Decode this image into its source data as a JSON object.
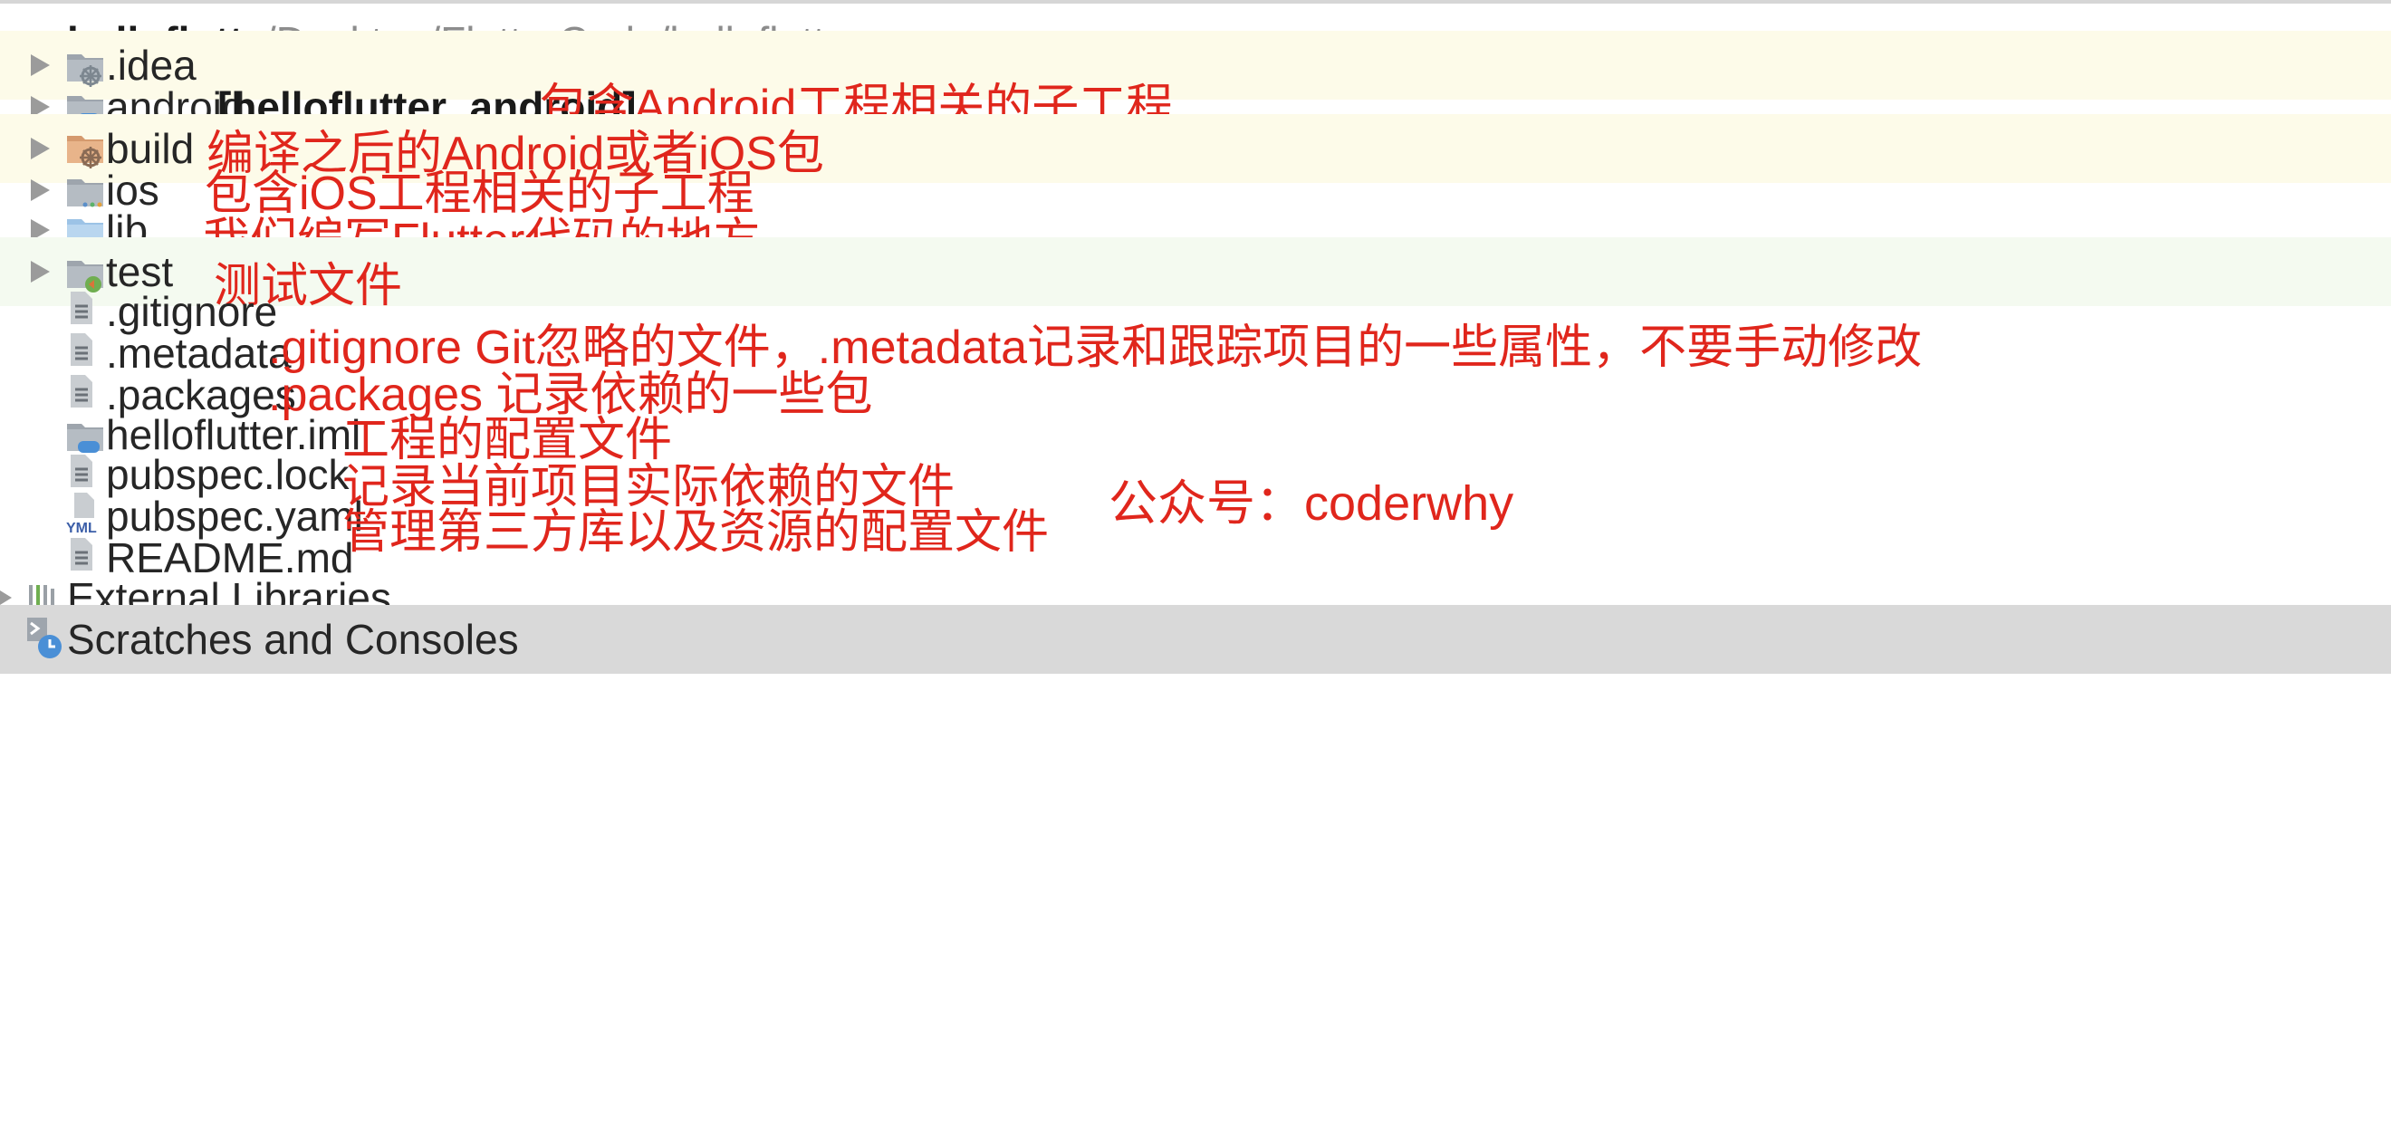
{
  "project": {
    "name": "helloflutter",
    "path": "~/Desktop/FlutterCode/helloflutter"
  },
  "tree": [
    {
      "label": ".idea",
      "module": "",
      "icon": "idea-folder-icon",
      "note": ""
    },
    {
      "label": "android",
      "module": "[helloflutter_android]",
      "icon": "module-folder-icon",
      "note": "包含Android工程相关的子工程"
    },
    {
      "label": "build",
      "icon": "excluded-folder-icon",
      "note": "编译之后的Android或者iOS包"
    },
    {
      "label": "ios",
      "icon": "folder-icon",
      "note": "包含iOS工程相关的子工程"
    },
    {
      "label": "lib",
      "icon": "source-folder-icon",
      "note": "我们编写Flutter代码的地方"
    },
    {
      "label": "test",
      "icon": "test-folder-icon",
      "note": "测试文件"
    },
    {
      "label": ".gitignore",
      "icon": "text-file-icon",
      "note": ".gitignore Git忽略的文件，.metadata记录和跟踪项目的一些属性，不要手动修改"
    },
    {
      "label": ".metadata",
      "icon": "text-file-icon"
    },
    {
      "label": ".packages",
      "icon": "text-file-icon",
      "note": ".packages 记录依赖的一些包"
    },
    {
      "label": "helloflutter.iml",
      "icon": "module-file-icon",
      "note": "工程的配置文件"
    },
    {
      "label": "pubspec.lock",
      "icon": "text-file-icon",
      "note": "记录当前项目实际依赖的文件"
    },
    {
      "label": "pubspec.yaml",
      "icon": "yaml-file-icon",
      "icon_text": "YML",
      "note": "管理第三方库以及资源的配置文件"
    },
    {
      "label": "README.md",
      "icon": "text-file-icon"
    }
  ],
  "external_libraries": "External Libraries",
  "scratches": "Scratches and Consoles",
  "watermark": "公众号：coderwhy",
  "colors": {
    "annotation": "#e0261c",
    "row_highlight_yellow": "#fdfbe9",
    "row_highlight_green": "#f4faf0",
    "row_selected": "#d9d9d9"
  }
}
